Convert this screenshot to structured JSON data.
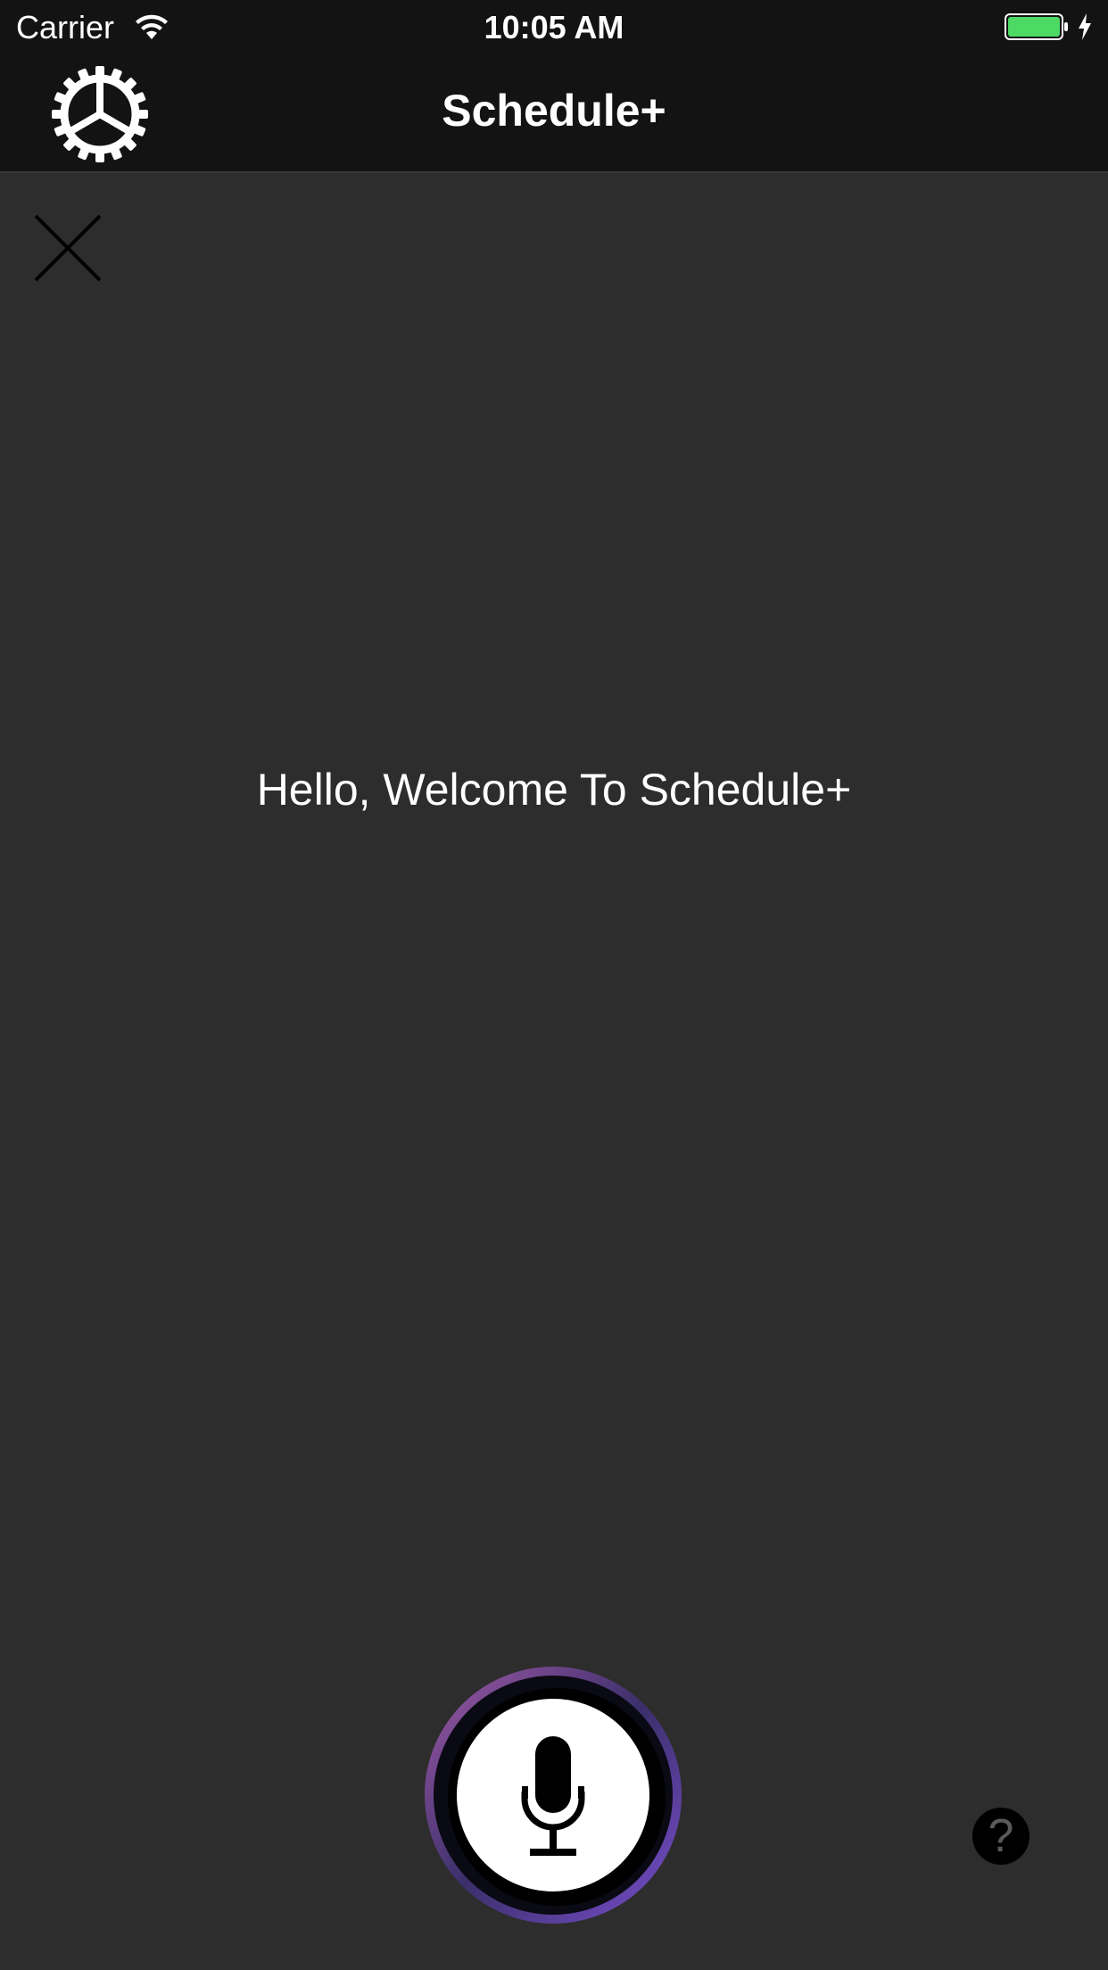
{
  "status_bar": {
    "carrier": "Carrier",
    "time": "10:05 AM",
    "wifi_icon": "wifi-icon",
    "battery_icon": "battery-icon",
    "charging_icon": "charging-bolt-icon",
    "battery_color": "#4cd964"
  },
  "nav_bar": {
    "title": "Schedule+",
    "settings_icon": "gear-icon"
  },
  "main": {
    "close_icon": "close-icon",
    "welcome_text": "Hello, Welcome To Schedule+"
  },
  "bottom": {
    "mic_icon": "microphone-icon",
    "help_label": "?",
    "accent_colors": [
      "#9b59b6",
      "#6a4bc4",
      "#1a1a4a"
    ]
  },
  "colors": {
    "background": "#2d2d2d",
    "bar": "#131313",
    "text": "#ffffff"
  }
}
